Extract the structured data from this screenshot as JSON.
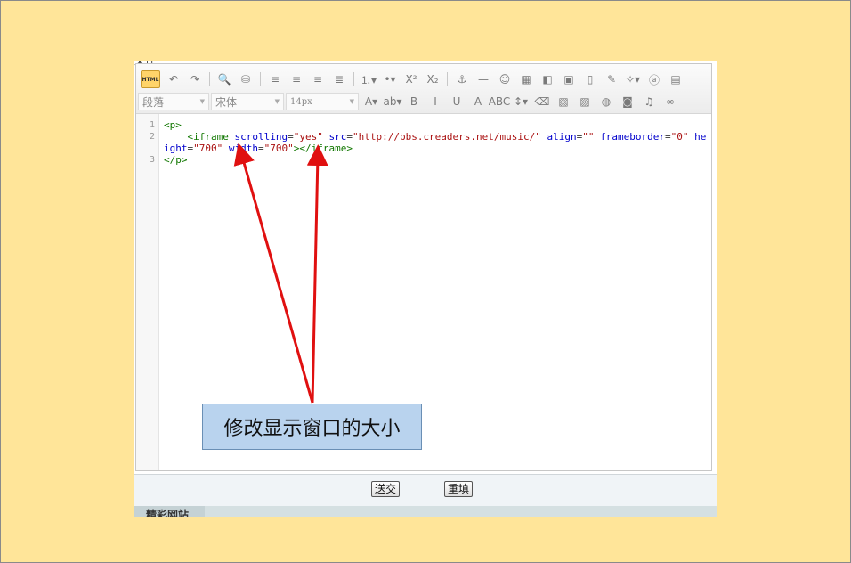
{
  "editor": {
    "cut_text": "文件",
    "toolbar": {
      "row1": [
        {
          "name": "html-source-button",
          "glyph": "HTML"
        },
        {
          "name": "undo-icon",
          "glyph": "↶"
        },
        {
          "name": "redo-icon",
          "glyph": "↷"
        },
        {
          "sep": true
        },
        {
          "name": "find-icon",
          "glyph": "🔍"
        },
        {
          "name": "binoculars-icon",
          "glyph": "⛁"
        },
        {
          "sep": true
        },
        {
          "name": "align-left-icon",
          "glyph": "≡"
        },
        {
          "name": "align-center-icon",
          "glyph": "≡"
        },
        {
          "name": "align-right-icon",
          "glyph": "≡"
        },
        {
          "name": "align-justify-icon",
          "glyph": "≣"
        },
        {
          "sep": true
        },
        {
          "name": "ordered-list-icon",
          "glyph": "⒈▾"
        },
        {
          "name": "unordered-list-icon",
          "glyph": "•▾"
        },
        {
          "name": "superscript-icon",
          "glyph": "X²"
        },
        {
          "name": "subscript-icon",
          "glyph": "X₂"
        },
        {
          "sep": true
        },
        {
          "name": "anchor-icon",
          "glyph": "⚓"
        },
        {
          "name": "horizontal-rule-icon",
          "glyph": "—"
        },
        {
          "name": "emoticon-icon",
          "glyph": "☺"
        },
        {
          "name": "table-icon",
          "glyph": "▦"
        },
        {
          "name": "image-map-icon",
          "glyph": "◧"
        },
        {
          "name": "save-icon",
          "glyph": "▣"
        },
        {
          "name": "page-icon",
          "glyph": "▯"
        },
        {
          "name": "clear-format-icon",
          "glyph": "✎"
        },
        {
          "name": "magic-wand-icon",
          "glyph": "✧▾"
        },
        {
          "name": "special-char-icon",
          "glyph": "ⓐ"
        },
        {
          "name": "paste-icon",
          "glyph": "▤"
        }
      ],
      "row2_selects": {
        "paragraph": "段落",
        "font": "宋体",
        "size": "14px"
      },
      "row2": [
        {
          "name": "font-color-icon",
          "glyph": "A▾"
        },
        {
          "name": "highlight-icon",
          "glyph": "ab▾"
        },
        {
          "name": "bold-icon",
          "glyph": "B"
        },
        {
          "name": "italic-icon",
          "glyph": "I"
        },
        {
          "name": "underline-icon",
          "glyph": "U"
        },
        {
          "name": "border-text-icon",
          "glyph": "A"
        },
        {
          "name": "strikethrough-icon",
          "glyph": "ABC"
        },
        {
          "name": "line-height-icon",
          "glyph": "↕▾"
        },
        {
          "name": "eraser-icon",
          "glyph": "⌫"
        },
        {
          "name": "image-icon",
          "glyph": "▧"
        },
        {
          "name": "multi-image-icon",
          "glyph": "▨"
        },
        {
          "name": "flash-icon",
          "glyph": "◍"
        },
        {
          "name": "video-icon",
          "glyph": "◙"
        },
        {
          "name": "music-icon",
          "glyph": "♫"
        },
        {
          "name": "link-icon",
          "glyph": "∞"
        }
      ]
    },
    "code": {
      "line_numbers": [
        "1",
        "2",
        "3"
      ],
      "line1_tag": "<p>",
      "line2": {
        "indent": "    ",
        "open": "<iframe",
        "attr_scrolling": " scrolling",
        "eq1": "=",
        "val_scrolling": "\"yes\"",
        "attr_src": " src",
        "eq2": "=",
        "val_src": "\"http://bbs.creaders.net/music/\"",
        "attr_align": " align",
        "eq3": "=",
        "val_align": "\"\"",
        "attr_frameborder": " frameborder",
        "eq4": "=",
        "val_frameborder": "\"0\"",
        "attr_height": " height",
        "eq5": "=",
        "val_height": "\"700\"",
        "attr_width": " width",
        "eq6": "=",
        "val_width": "\"700\"",
        "close": "></iframe>"
      },
      "line3_tag": "</p>"
    }
  },
  "form": {
    "submit_label": "送交",
    "reset_label": "重填"
  },
  "footer": {
    "section_title": "精彩网站"
  },
  "annotation": {
    "callout_text": "修改显示窗口的大小",
    "arrow_color": "#e01010"
  },
  "colors": {
    "slide_background": "#ffe599",
    "callout_fill": "#b9d3ee"
  }
}
